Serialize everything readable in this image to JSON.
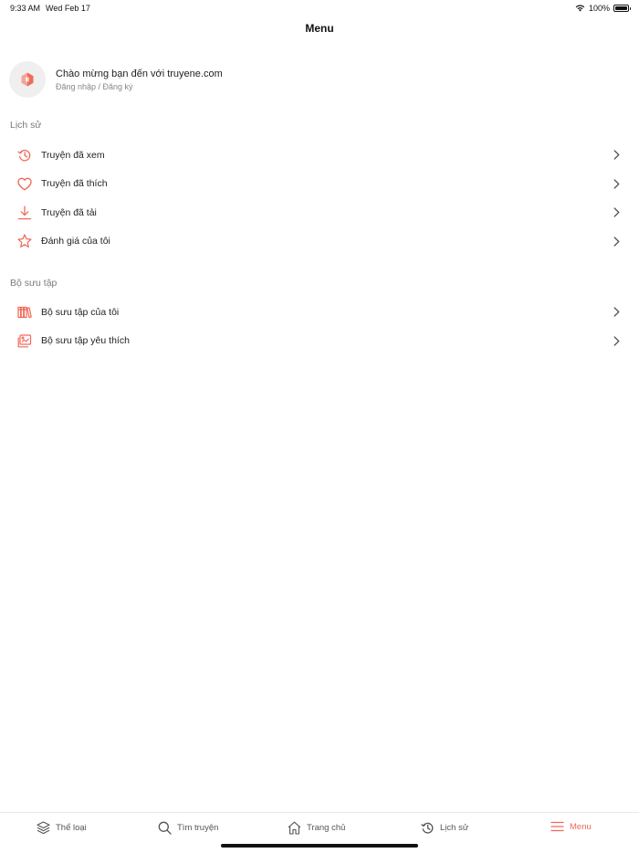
{
  "status_bar": {
    "time": "9:33 AM",
    "date": "Wed Feb 17",
    "battery": "100%"
  },
  "nav": {
    "title": "Menu"
  },
  "profile": {
    "welcome": "Chào mừng bạn đến với truyene.com",
    "login_link": "Đăng nhập / Đăng ký"
  },
  "history_section": {
    "title": "Lịch sử",
    "items": [
      {
        "label": "Truyện đã xem",
        "icon": "history-icon"
      },
      {
        "label": "Truyện đã thích",
        "icon": "heart-icon"
      },
      {
        "label": "Truyện đã tải",
        "icon": "download-icon"
      },
      {
        "label": "Đánh giá của tôi",
        "icon": "star-icon"
      }
    ]
  },
  "collection_section": {
    "title": "Bộ sưu tập",
    "items": [
      {
        "label": "Bộ sưu tập của tôi",
        "icon": "books-icon"
      },
      {
        "label": "Bộ sưu tập yêu thích",
        "icon": "album-icon"
      }
    ]
  },
  "tab_bar": {
    "tabs": [
      {
        "label": "Thể loại",
        "icon": "layers-icon"
      },
      {
        "label": "Tìm truyện",
        "icon": "search-icon"
      },
      {
        "label": "Trang chủ",
        "icon": "home-icon"
      },
      {
        "label": "Lịch sử",
        "icon": "history-icon"
      },
      {
        "label": "Menu",
        "icon": "menu-icon"
      }
    ],
    "active": "Menu"
  },
  "colors": {
    "accent": "#f0695a",
    "text": "#222222",
    "muted": "#7a7a7a",
    "avatar_bg": "#efefef"
  }
}
